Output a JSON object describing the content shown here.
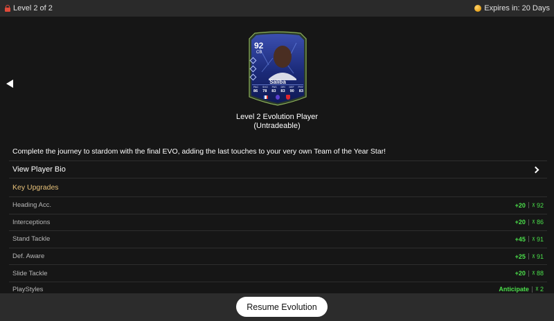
{
  "topbar": {
    "level": "Level 2 of 2",
    "expires": "Expires in: 20 Days"
  },
  "card": {
    "rating": "92",
    "position": "CB",
    "name": "Saliba",
    "stat_labels": [
      "PAC",
      "SHO",
      "PAS",
      "DRI",
      "DEF",
      "PHY"
    ],
    "stat_values": [
      "86",
      "78",
      "83",
      "83",
      "90",
      "83"
    ]
  },
  "evolution": {
    "title": "Level 2 Evolution Player",
    "subtitle": "(Untradeable)"
  },
  "description": "Complete the journey to stardom with the final EVO, adding the last touches to your very own Team of the Year Star!",
  "bio": {
    "label": "View Player Bio"
  },
  "upgrades": {
    "title": "Key Upgrades",
    "rows": [
      {
        "name": "Heading Acc.",
        "boost": "+20",
        "cap": "92"
      },
      {
        "name": "Interceptions",
        "boost": "+20",
        "cap": "86"
      },
      {
        "name": "Stand Tackle",
        "boost": "+45",
        "cap": "91"
      },
      {
        "name": "Def. Aware",
        "boost": "+25",
        "cap": "91"
      },
      {
        "name": "Slide Tackle",
        "boost": "+20",
        "cap": "88"
      },
      {
        "name": "PlayStyles",
        "boost": "Anticipate",
        "cap": "2"
      }
    ]
  },
  "resume_button": {
    "label": "Resume Evolution"
  },
  "colors": {
    "accent_gold": "#e8c27a",
    "boost_green": "#4be04b",
    "lock_red": "#e04a3a"
  }
}
